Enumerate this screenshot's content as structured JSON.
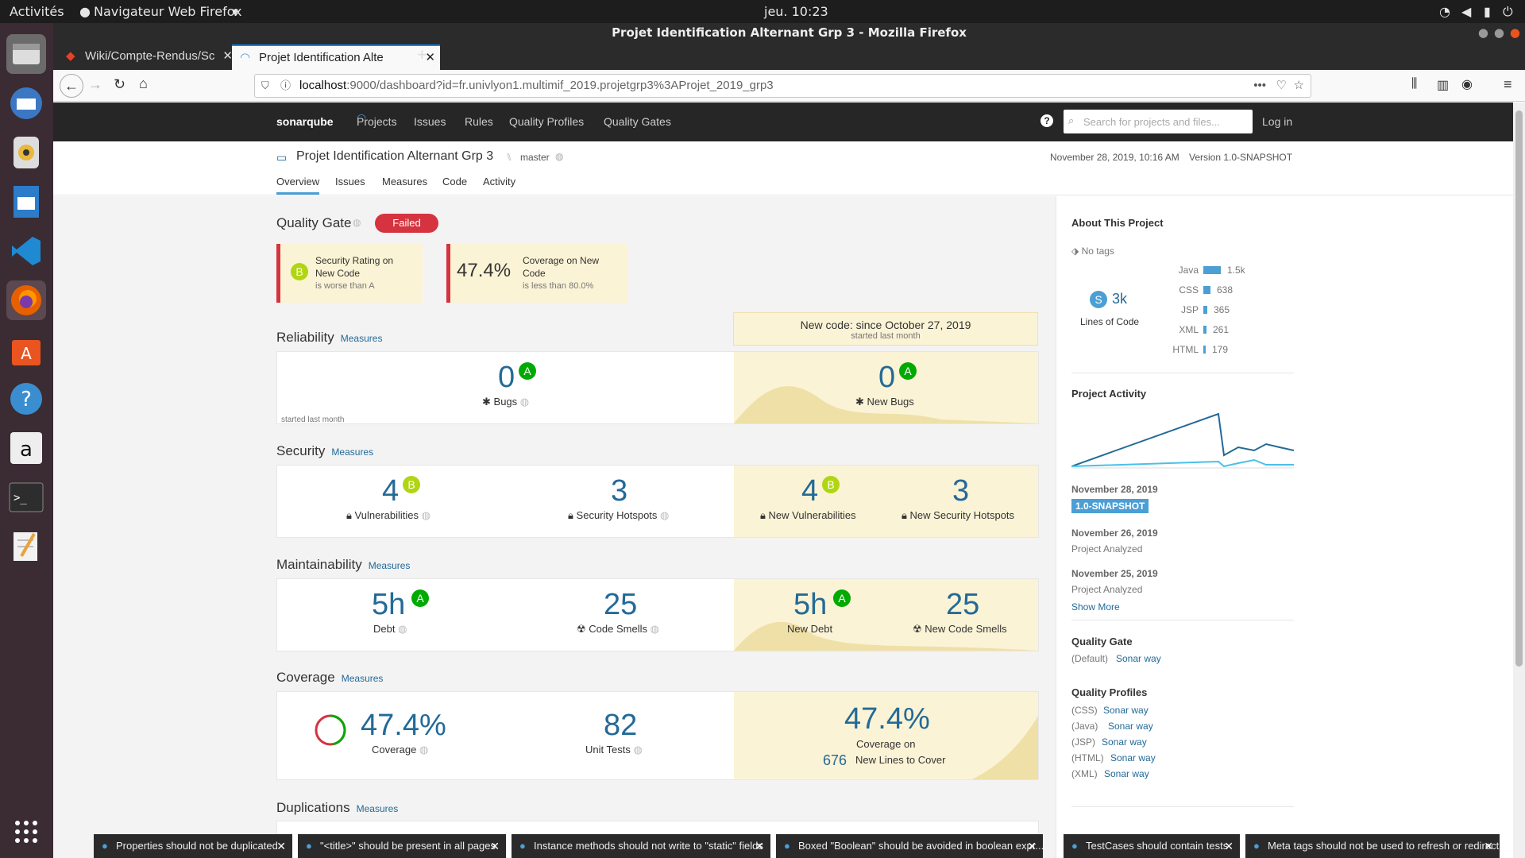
{
  "os": {
    "activities": "Activités",
    "app_menu": "Navigateur Web Firefox",
    "clock": "jeu. 10:23"
  },
  "window": {
    "title": "Projet Identification Alternant Grp 3 - Mozilla Firefox"
  },
  "tabs": [
    {
      "label": "Wiki/Compte-Rendus/Sc"
    },
    {
      "label": "Projet Identification Alte"
    }
  ],
  "url": {
    "host": "localhost",
    "rest": ":9000/dashboard?id=fr.univlyon1.multimif_2019.projetgrp3%3AProjet_2019_grp3"
  },
  "sonar": {
    "logo": "sonarqube",
    "nav": [
      "Projects",
      "Issues",
      "Rules",
      "Quality Profiles",
      "Quality Gates"
    ],
    "search_placeholder": "Search for projects and files...",
    "login": "Log in"
  },
  "project": {
    "name": "Projet Identification Alternant Grp 3",
    "branch": "master",
    "date": "November 28, 2019, 10:16 AM",
    "version": "Version 1.0-SNAPSHOT",
    "tabs": [
      "Overview",
      "Issues",
      "Measures",
      "Code",
      "Activity"
    ]
  },
  "quality_gate": {
    "title": "Quality Gate",
    "status": "Failed",
    "conditions": [
      {
        "rating": "B",
        "line1": "Security Rating on",
        "line2": "New Code",
        "sub": "is worse than A"
      },
      {
        "value": "47.4%",
        "line1": "Coverage on New",
        "line2": "Code",
        "sub": "is less than 80.0%"
      }
    ]
  },
  "measures_link": "Measures",
  "newcode": {
    "title": "New code: since October 27, 2019",
    "sub": "started last month"
  },
  "reliability": {
    "title": "Reliability",
    "bugs": "0",
    "bugs_rating": "A",
    "bugs_label": "Bugs",
    "new_bugs": "0",
    "new_bugs_rating": "A",
    "new_bugs_label": "New Bugs",
    "footnote": "started last month"
  },
  "security": {
    "title": "Security",
    "vuln": "4",
    "vuln_rating": "B",
    "vuln_label": "Vulnerabilities",
    "hotspots": "3",
    "hotspots_label": "Security Hotspots",
    "new_vuln": "4",
    "new_vuln_rating": "B",
    "new_vuln_label": "New Vulnerabilities",
    "new_hotspots": "3",
    "new_hotspots_label": "New Security Hotspots"
  },
  "maintainability": {
    "title": "Maintainability",
    "debt": "5h",
    "debt_rating": "A",
    "debt_label": "Debt",
    "smells": "25",
    "smells_label": "Code Smells",
    "new_debt": "5h",
    "new_debt_rating": "A",
    "new_debt_label": "New Debt",
    "new_smells": "25",
    "new_smells_label": "New Code Smells"
  },
  "coverage": {
    "title": "Coverage",
    "cov": "47.4%",
    "cov_label": "Coverage",
    "tests": "82",
    "tests_label": "Unit Tests",
    "new_cov": "47.4%",
    "new_cov_l1": "Coverage on",
    "new_lines": "676",
    "new_cov_l2": "New Lines to Cover",
    "progress": 0.474
  },
  "duplications": {
    "title": "Duplications"
  },
  "about": {
    "title": "About This Project",
    "tags": "No tags",
    "loc": "3k",
    "loc_rating": "S",
    "loc_label": "Lines of Code",
    "langs": [
      {
        "name": "Java",
        "count": "1.5k",
        "value": 1500
      },
      {
        "name": "CSS",
        "count": "638",
        "value": 638
      },
      {
        "name": "JSP",
        "count": "365",
        "value": 365
      },
      {
        "name": "XML",
        "count": "261",
        "value": 261
      },
      {
        "name": "HTML",
        "count": "179",
        "value": 179
      }
    ]
  },
  "activity": {
    "title": "Project Activity",
    "events": [
      {
        "date": "November 28, 2019",
        "badge": "1.0-SNAPSHOT"
      },
      {
        "date": "November 26, 2019",
        "desc": "Project Analyzed"
      },
      {
        "date": "November 25, 2019",
        "desc": "Project Analyzed"
      }
    ],
    "show_more": "Show More"
  },
  "qg_side": {
    "title": "Quality Gate",
    "default": "(Default)",
    "name": "Sonar way"
  },
  "qprofiles": {
    "title": "Quality Profiles",
    "items": [
      {
        "lang": "(CSS)",
        "name": "Sonar way"
      },
      {
        "lang": "(Java)",
        "name": "Sonar way"
      },
      {
        "lang": "(JSP)",
        "name": "Sonar way"
      },
      {
        "lang": "(HTML)",
        "name": "Sonar way"
      },
      {
        "lang": "(XML)",
        "name": "Sonar way"
      }
    ]
  },
  "toasts": [
    "Properties should not be duplicated",
    "\"<title>\" should be present in all pages",
    "Instance methods should not write to \"static\" fields",
    "Boxed \"Boolean\" should be avoided in boolean expr...",
    "TestCases should contain tests",
    "Meta tags should not be used to refresh or redirect"
  ]
}
